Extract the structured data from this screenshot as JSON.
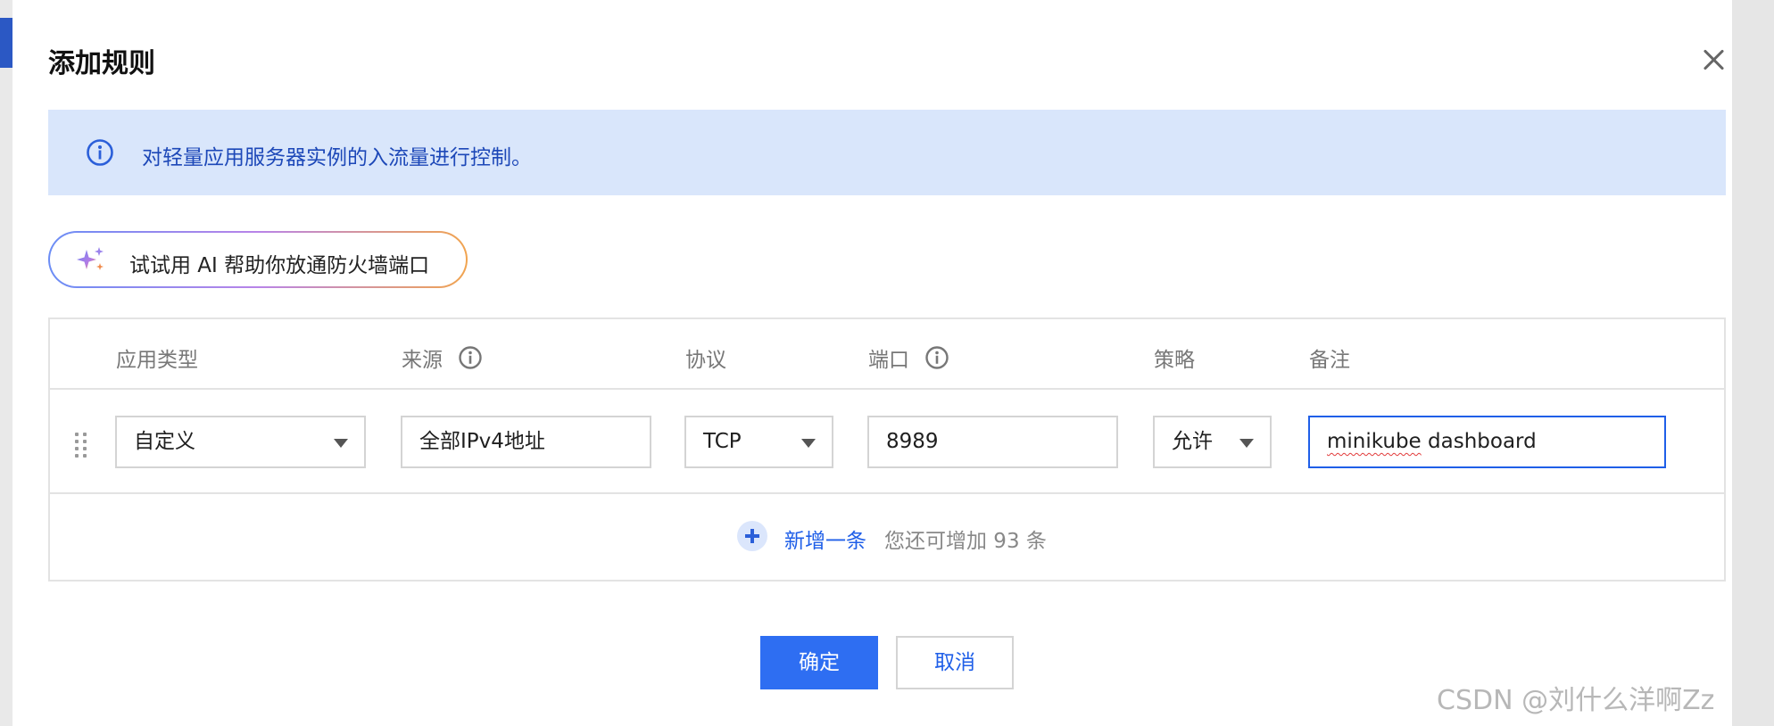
{
  "dialog": {
    "title": "添加规则",
    "close_icon": "close-icon"
  },
  "notice": {
    "icon": "info-icon",
    "text": "对轻量应用服务器实例的入流量进行控制。",
    "color": "#1d48b8"
  },
  "ai_button": {
    "icon": "sparkle-icon",
    "label": "试试用 AI 帮助你放通防火墙端口"
  },
  "table": {
    "columns": [
      {
        "label": "应用类型",
        "has_info": false
      },
      {
        "label": "来源",
        "has_info": true
      },
      {
        "label": "协议",
        "has_info": false
      },
      {
        "label": "端口",
        "has_info": true
      },
      {
        "label": "策略",
        "has_info": false
      },
      {
        "label": "备注",
        "has_info": false
      }
    ],
    "row": {
      "app_type": "自定义",
      "source": "全部IPv4地址",
      "protocol": "TCP",
      "port": "8989",
      "policy": "允许",
      "remark_word1": "minikube",
      "remark_word2": "dashboard"
    },
    "add": {
      "label": "新增一条",
      "hint": "您还可增加 93 条"
    }
  },
  "footer": {
    "confirm": "确定",
    "cancel": "取消"
  },
  "watermark": "CSDN @刘什么洋啊Zz",
  "colors": {
    "primary": "#2e6ef2",
    "notice_bg": "#d9e6fb"
  }
}
